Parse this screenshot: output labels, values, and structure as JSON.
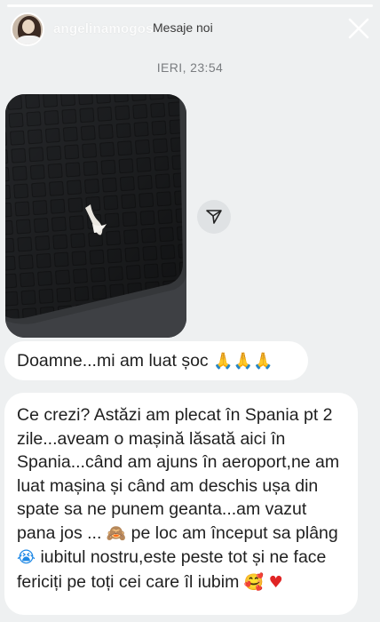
{
  "header": {
    "username": "angelinamogos",
    "title": "Mesaje noi",
    "close_label": "close"
  },
  "conversation": {
    "timestamp": "IERI, 23:54",
    "messages": [
      {
        "type": "image",
        "description_icon": "photo-attachment"
      },
      {
        "type": "text",
        "text": "Doamne...mi am luat șoc",
        "emojis": [
          "🙏",
          "🙏",
          "🙏"
        ]
      },
      {
        "type": "text",
        "text": "Ce crezi? Astăzi am plecat în Spania pt 2 zile...aveam o mașină lăsată aici în Spania...când am ajuns în aeroport,ne am luat mașina și când am deschis ușa din spate sa ne punem geanta...am vazut pana jos ...",
        "emoji_1": "🙈",
        "text_2": " pe loc am început sa plâng ",
        "emoji_2": "😭",
        "text_3": " iubitul nostru,este peste tot și ne face fericiți pe toți cei care îl iubim ",
        "emoji_3": "🥰",
        "emoji_4": "♥"
      }
    ]
  },
  "icons": {
    "close": "close-icon",
    "share": "share-icon"
  },
  "colors": {
    "background": "#eef0f1",
    "bubble": "#ffffff",
    "text": "#1f1f1f",
    "timestamp": "#7a7d80"
  }
}
